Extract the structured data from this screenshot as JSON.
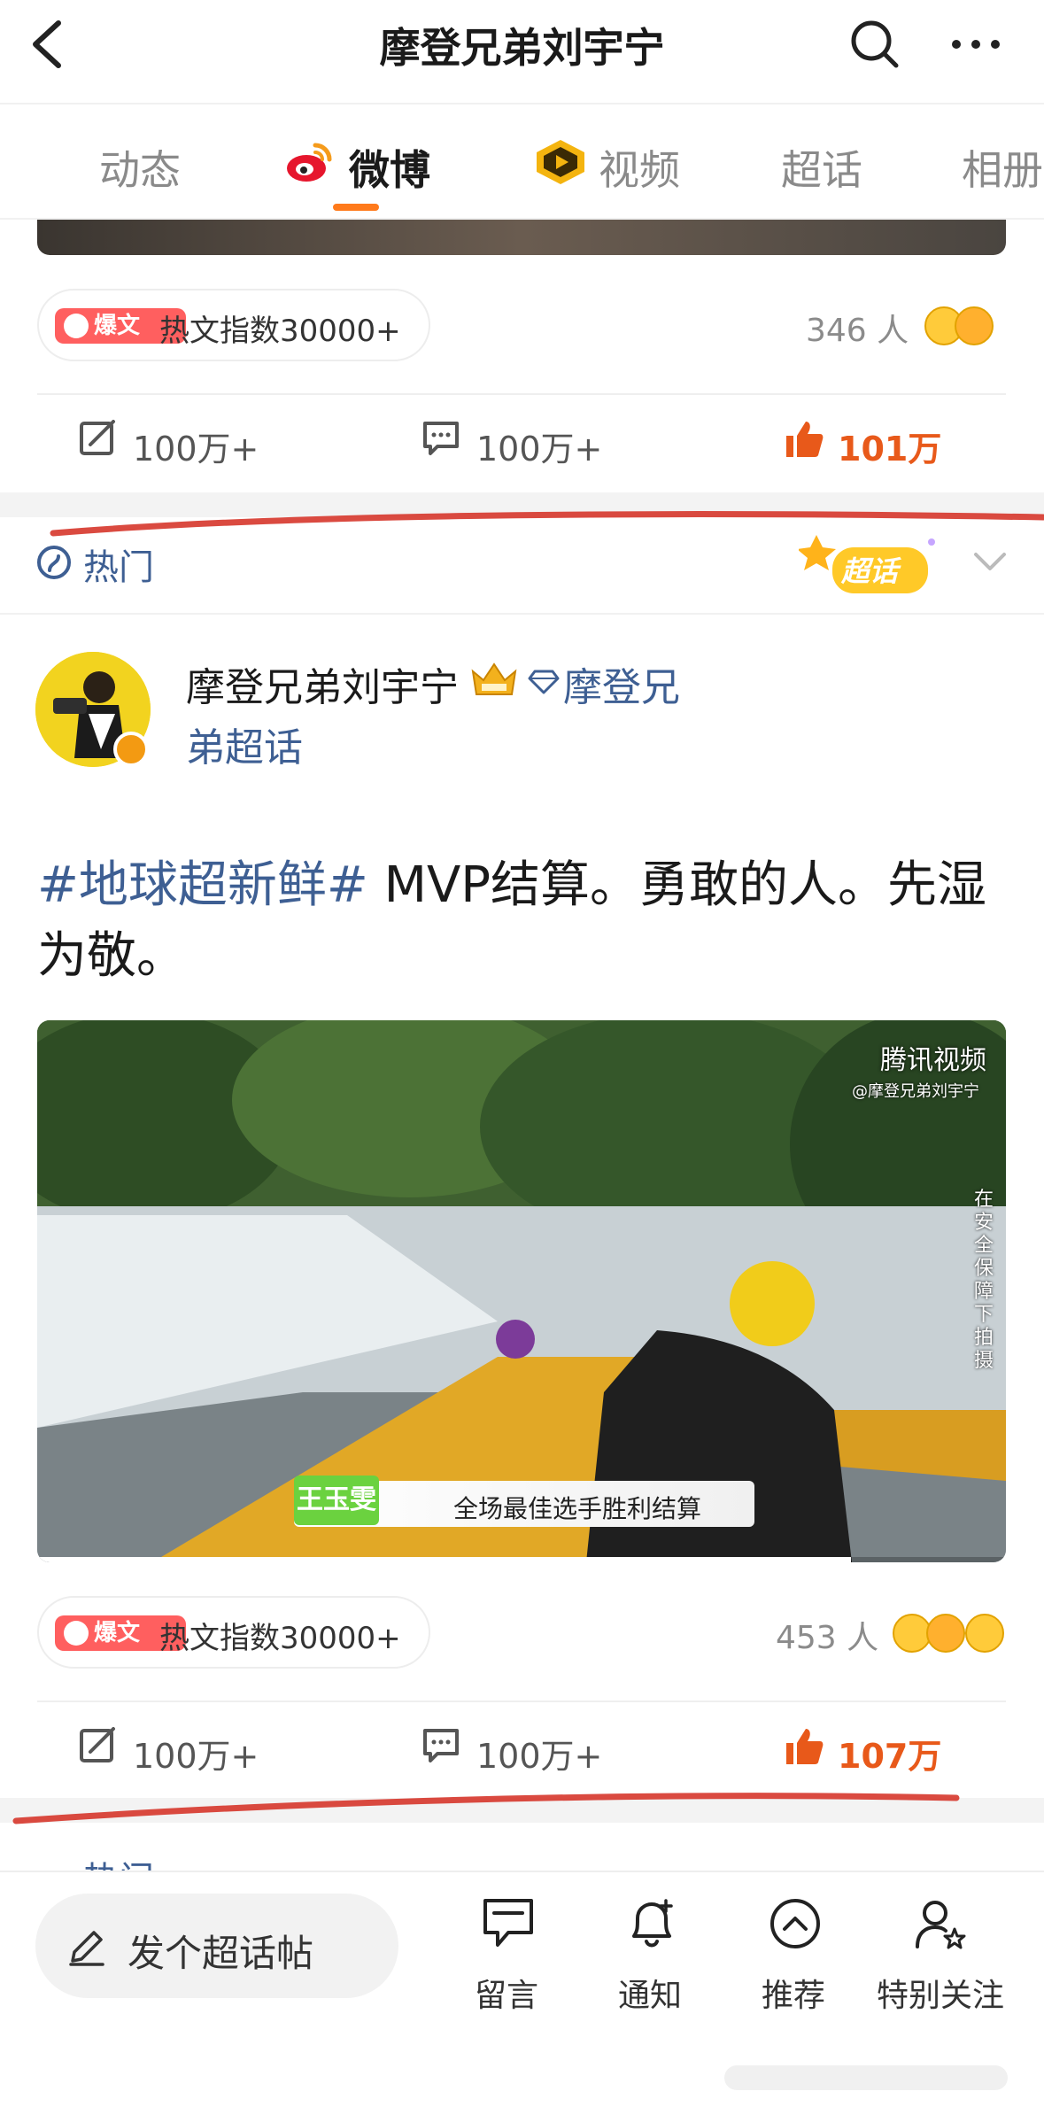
{
  "header": {
    "title": "摩登兄弟刘宇宁"
  },
  "tabs": [
    {
      "label": "动态"
    },
    {
      "label": "微博"
    },
    {
      "label": "视频"
    },
    {
      "label": "超话"
    },
    {
      "label": "相册"
    }
  ],
  "post1": {
    "hot_badge": "爆文",
    "hot_index": "热文指数30000+",
    "people": "346 人",
    "repost": "100万+",
    "comment": "100万+",
    "like": "101万"
  },
  "hot_section": {
    "label": "热门",
    "sticker": "超话"
  },
  "post2": {
    "author": "摩登兄弟刘宇宁",
    "community_line1": "摩登兄",
    "community_line2": "弟超话",
    "hashtag": "#地球超新鲜#",
    "text": " MVP结算。勇敢的人。先湿为敬。",
    "video": {
      "watermark": "腾讯视频",
      "watermark_sub": "@摩登兄弟刘宇宁",
      "vertical_note": "在安全保障下拍摄",
      "name_tag": "王玉雯",
      "subtitle": "全场最佳选手胜利结算",
      "progress": 0.84
    },
    "hot_badge": "爆文",
    "hot_index": "热文指数30000+",
    "people": "453 人",
    "repost": "100万+",
    "comment": "100万+",
    "like": "107万"
  },
  "next_section": {
    "label": "热门"
  },
  "bottom_bar": {
    "compose": "发个超话帖",
    "items": [
      {
        "label": "留言",
        "icon": "message-icon"
      },
      {
        "label": "通知",
        "icon": "bell-icon"
      },
      {
        "label": "推荐",
        "icon": "recommend-icon"
      },
      {
        "label": "特别关注",
        "icon": "special-follow-icon"
      }
    ]
  },
  "colors": {
    "accent": "#ff7a1b",
    "link": "#3e5f93",
    "like": "#e8591a",
    "hot_badge": "#ff5f5f"
  }
}
